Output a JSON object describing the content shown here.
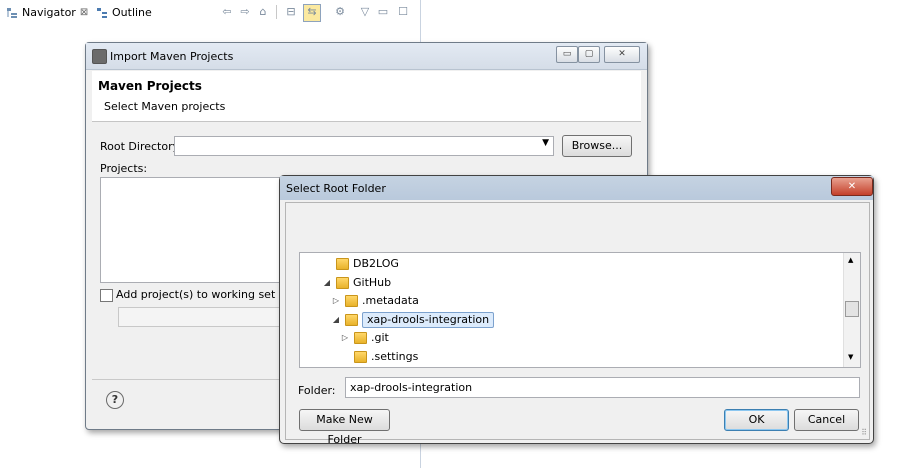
{
  "views": {
    "navigator_tab": "Navigator",
    "navigator_close": "⊠",
    "outline_tab": "Outline"
  },
  "import_dialog": {
    "title": "Import Maven Projects",
    "heading": "Maven Projects",
    "subheading": "Select Maven projects",
    "root_directory_label": "Root Directory:",
    "root_directory_value": "",
    "browse_label": "Browse...",
    "projects_label": "Projects:",
    "add_to_working_set_label": "Add project(s) to working set",
    "help_glyph": "?"
  },
  "folder_dialog": {
    "title": "Select Root Folder",
    "close_glyph": "✕",
    "tree": [
      {
        "label": "DB2LOG",
        "expander": "",
        "indent": 0,
        "selected": false
      },
      {
        "label": "GitHub",
        "expander": "◢",
        "indent": 0,
        "selected": false
      },
      {
        "label": ".metadata",
        "expander": "▷",
        "indent": 1,
        "selected": false
      },
      {
        "label": "xap-drools-integration",
        "expander": "◢",
        "indent": 1,
        "selected": true
      },
      {
        "label": ".git",
        "expander": "▷",
        "indent": 2,
        "selected": false
      },
      {
        "label": ".settings",
        "expander": "",
        "indent": 2,
        "selected": false
      }
    ],
    "folder_label": "Folder:",
    "folder_value": "xap-drools-integration",
    "make_new_folder_label": "Make New Folder",
    "ok_label": "OK",
    "cancel_label": "Cancel"
  }
}
